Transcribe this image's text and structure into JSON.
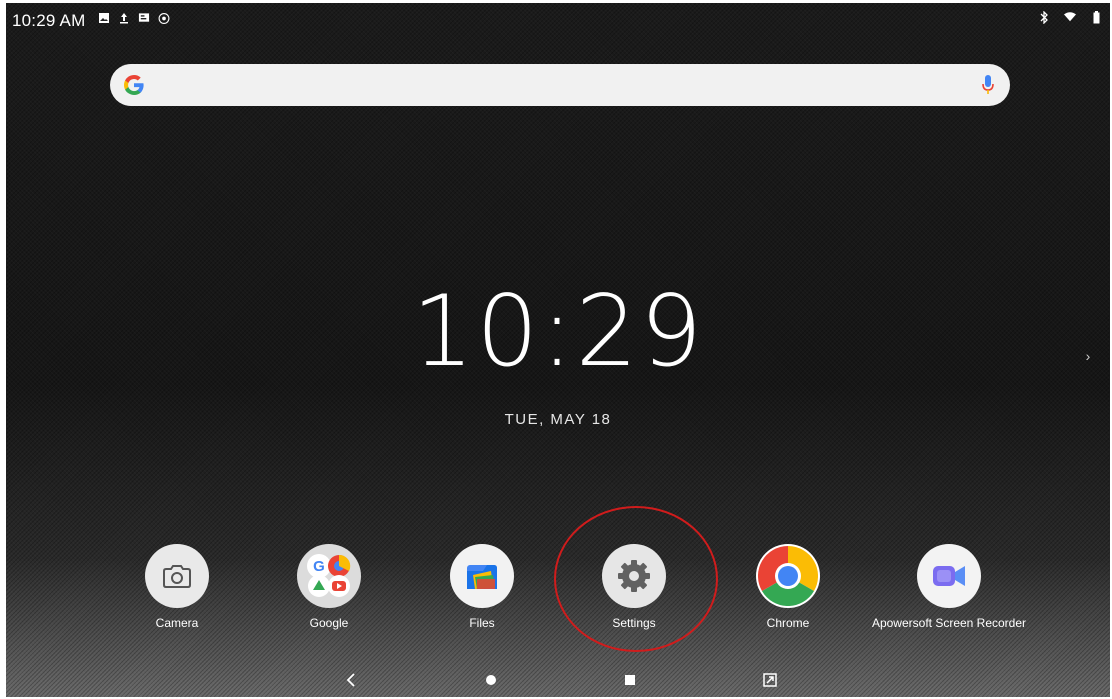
{
  "status_bar": {
    "time": "10:29 AM",
    "left_icons": [
      "image-icon",
      "upload-icon",
      "message-icon",
      "sync-icon"
    ],
    "right_icons": [
      "bluetooth-icon",
      "wifi-icon",
      "battery-icon"
    ]
  },
  "search": {
    "logo": "G",
    "mic_icon": "mic-icon"
  },
  "clock": {
    "time": "10:29",
    "date": "TUE, MAY 18"
  },
  "dock": {
    "apps": [
      {
        "label": "Camera"
      },
      {
        "label": "Google"
      },
      {
        "label": "Files"
      },
      {
        "label": "Settings"
      },
      {
        "label": "Chrome"
      },
      {
        "label": "Apowersoft Screen Recorder"
      }
    ],
    "highlighted": "Settings",
    "highlight_color": "#d01c1c"
  },
  "nav_bar": {
    "buttons": [
      "back-icon",
      "home-icon",
      "recents-icon",
      "screenshot-icon"
    ]
  },
  "colors": {
    "accent_google_blue": "#4285f4",
    "accent_google_red": "#ea4335",
    "accent_google_yellow": "#fbbc05",
    "accent_google_green": "#34a853"
  }
}
